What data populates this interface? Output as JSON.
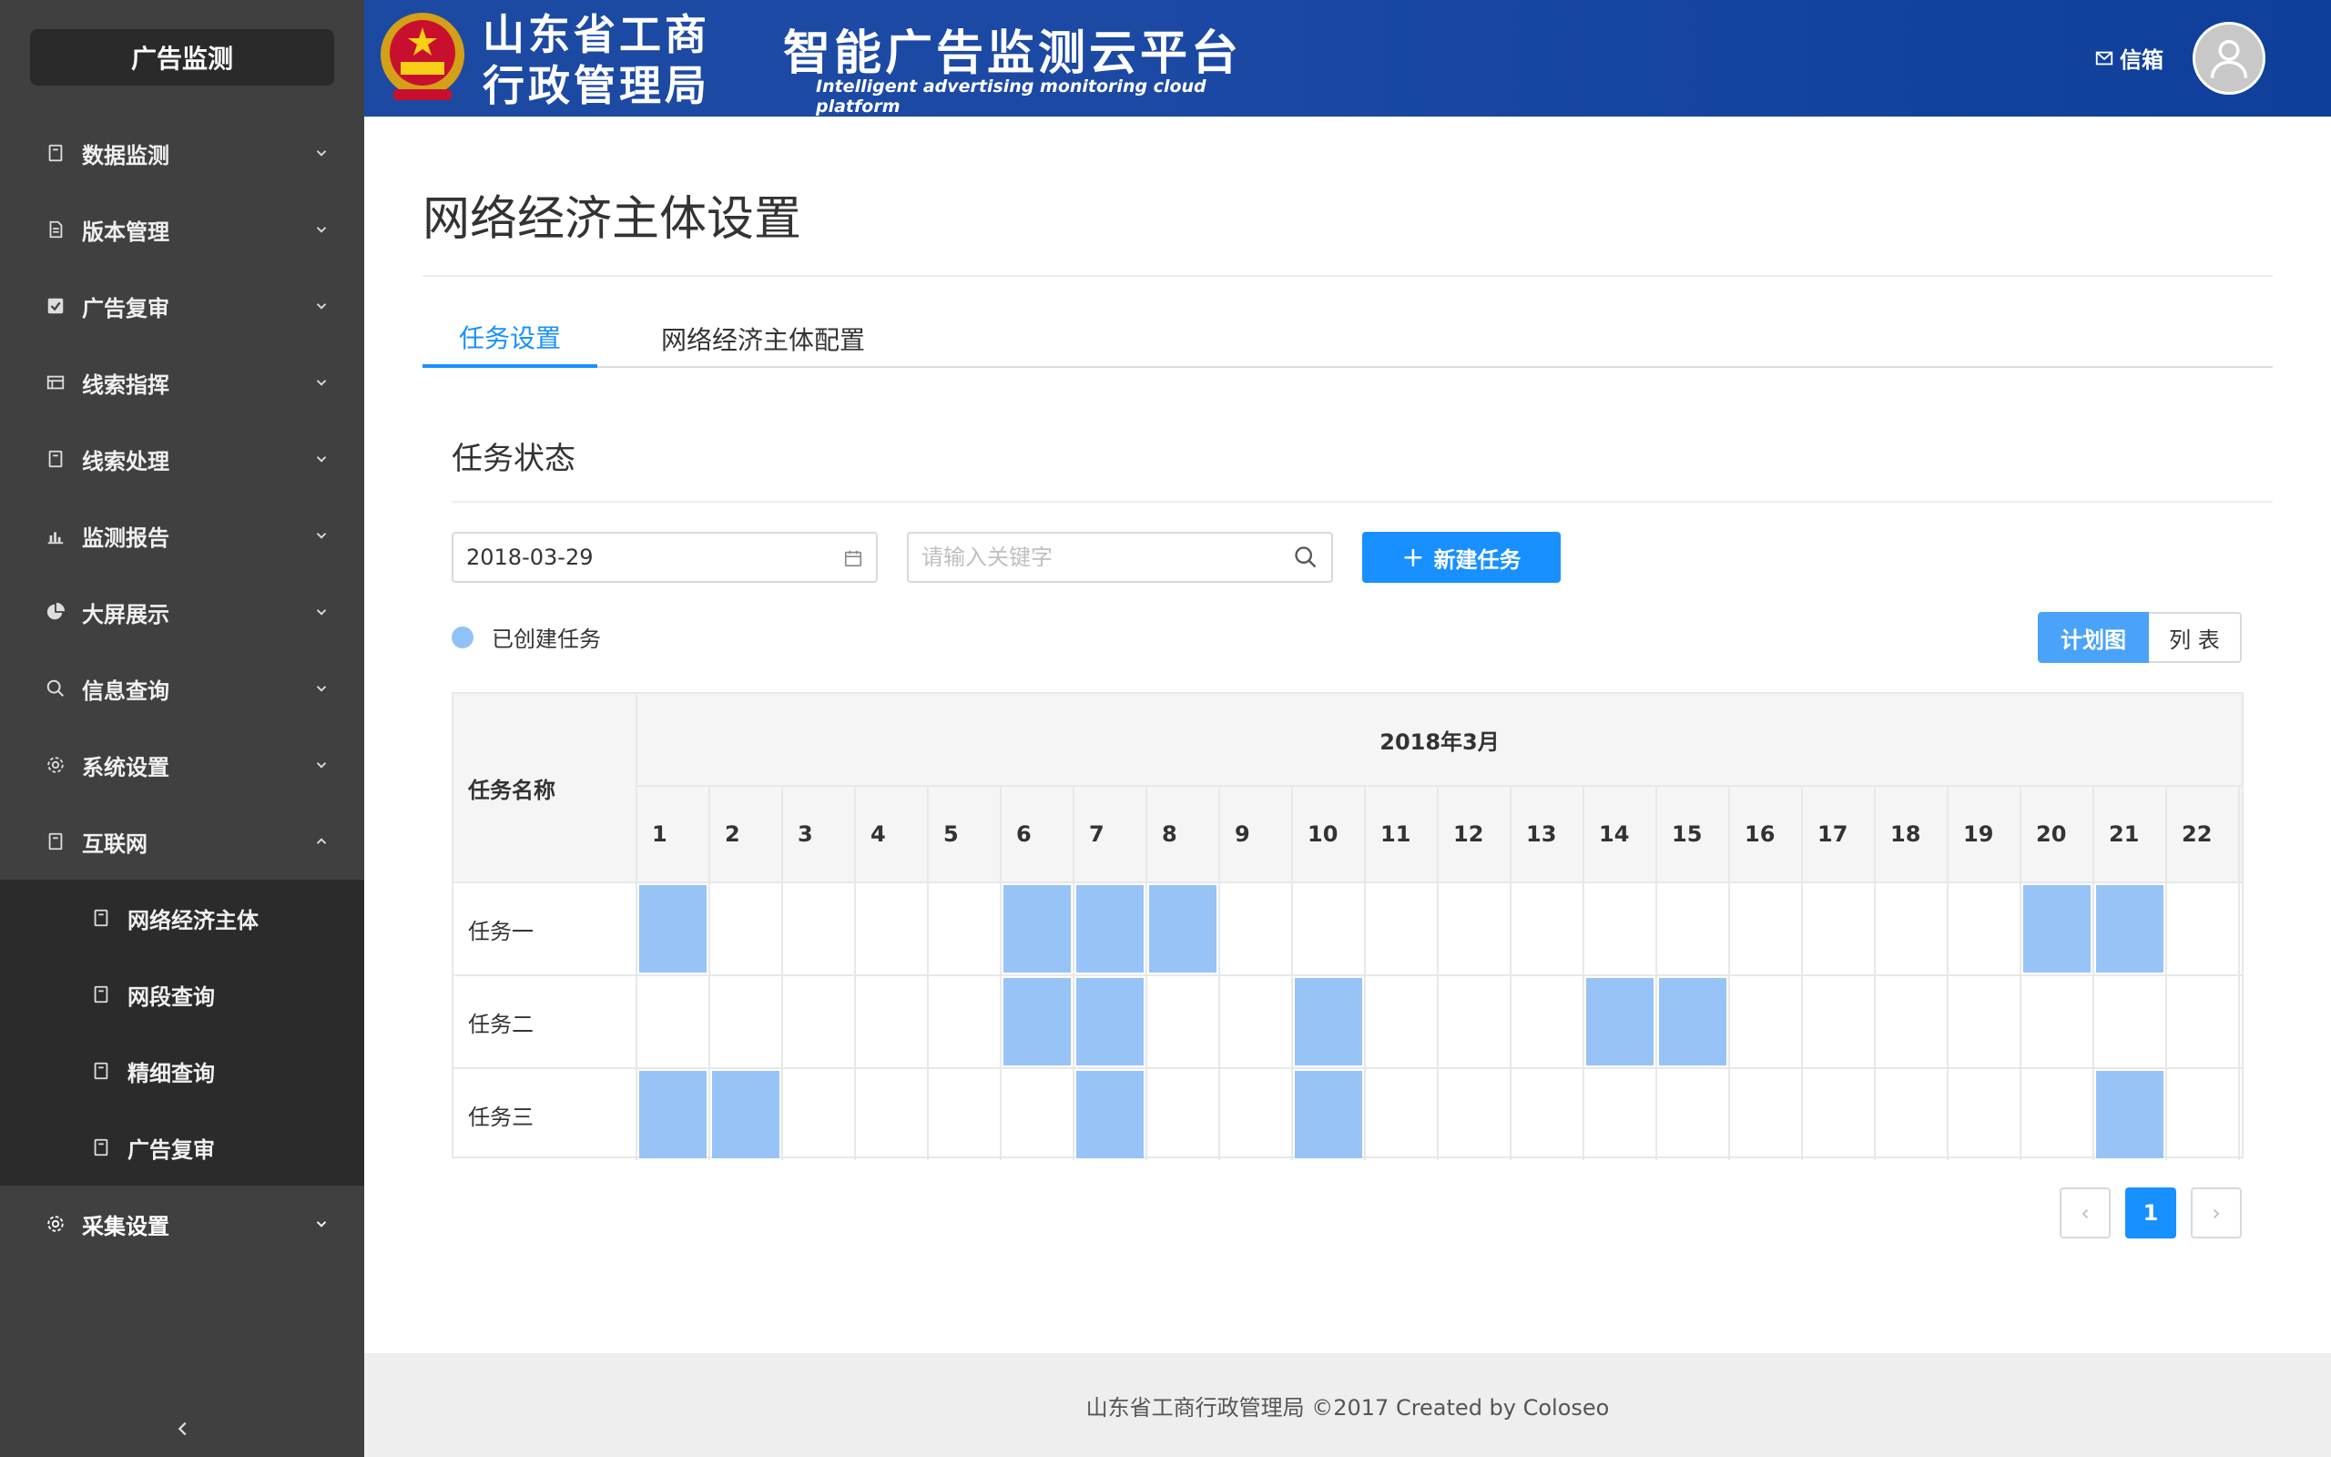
{
  "sidebar": {
    "logo": "广告监测",
    "items": [
      {
        "label": "数据监测",
        "icon": "document-icon"
      },
      {
        "label": "版本管理",
        "icon": "file-icon"
      },
      {
        "label": "广告复审",
        "icon": "checkbox-icon"
      },
      {
        "label": "线索指挥",
        "icon": "list-icon"
      },
      {
        "label": "线索处理",
        "icon": "document-icon"
      },
      {
        "label": "监测报告",
        "icon": "bar-chart-icon"
      },
      {
        "label": "大屏展示",
        "icon": "pie-chart-icon"
      },
      {
        "label": "信息查询",
        "icon": "search-icon"
      },
      {
        "label": "系统设置",
        "icon": "gear-icon"
      },
      {
        "label": "互联网",
        "icon": "document-icon"
      }
    ],
    "submenu": [
      {
        "label": "网络经济主体"
      },
      {
        "label": "网段查询"
      },
      {
        "label": "精细查询"
      },
      {
        "label": "广告复审"
      }
    ],
    "last_item": {
      "label": "采集设置",
      "icon": "gear-icon"
    },
    "collapse_glyph": "‹"
  },
  "header": {
    "org_line1": "山东省工商",
    "org_line2": "行政管理局",
    "platform_title": "智能广告监测云平台",
    "platform_subtitle": "Intelligent advertising monitoring cloud platform",
    "mailbox_label": "信箱"
  },
  "main": {
    "page_title": "网络经济主体设置",
    "tabs": [
      {
        "label": "任务设置",
        "active": true
      },
      {
        "label": "网络经济主体配置",
        "active": false
      }
    ],
    "section_title": "任务状态",
    "date_value": "2018-03-29",
    "search_placeholder": "请输入关键字",
    "new_task_label": "新建任务",
    "legend_label": "已创建任务",
    "view_plan_label": "计划图",
    "view_list_label": "列 表",
    "gantt": {
      "name_header": "任务名称",
      "month_label": "2018年3月",
      "days": [
        "1",
        "2",
        "3",
        "4",
        "5",
        "6",
        "7",
        "8",
        "9",
        "10",
        "11",
        "12",
        "13",
        "14",
        "15",
        "16",
        "17",
        "18",
        "19",
        "20",
        "21",
        "22"
      ],
      "tasks": [
        {
          "name": "任务一",
          "active_days": [
            1,
            6,
            7,
            8,
            20,
            21
          ]
        },
        {
          "name": "任务二",
          "active_days": [
            6,
            7,
            10,
            14,
            15
          ]
        },
        {
          "name": "任务三",
          "active_days": [
            1,
            2,
            7,
            10,
            21
          ]
        }
      ]
    },
    "pagination": {
      "prev": "‹",
      "current": "1",
      "next": "›"
    }
  },
  "footer": {
    "text": "山东省工商行政管理局 ©2017 Created by Coloseo"
  },
  "colors": {
    "primary": "#1890ff",
    "task_fill": "#97c3f6",
    "sidebar_bg": "#404040",
    "header_bg": "#1b49a4"
  }
}
